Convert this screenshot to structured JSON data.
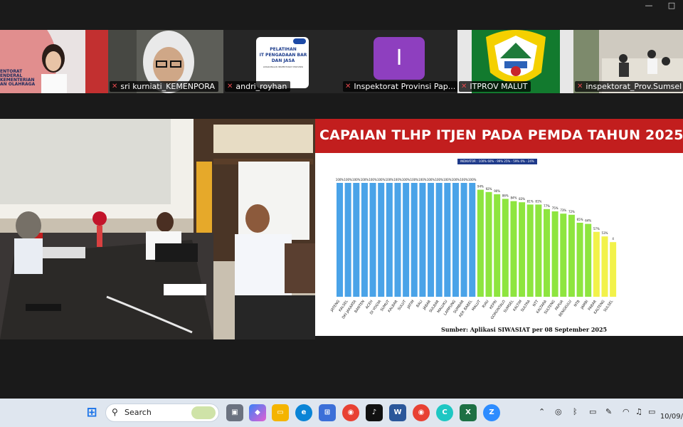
{
  "participants": [
    {
      "name": ""
    },
    {
      "name": "sri kurniati_KEMENPORA"
    },
    {
      "name": "andri_royhan"
    },
    {
      "name": "Inspektorat Provinsi Pap..."
    },
    {
      "name": "ITPROV MALUT"
    },
    {
      "name": "inspektorat_Prov.Sumsel"
    }
  ],
  "tile_texts": {
    "tile1_sign": "ENTORAT\nENDERAL\nKEMENTERIAN\nAN OLAHRAGA",
    "tile3_slide": "PELATIHAN\nIT PENGADAAN BAR\nDAN JASA",
    "tile3_sub": "LINGKUNGAN INSPEKTORAT PROVINSI",
    "tile4_initial": "I"
  },
  "shared_slide": {
    "title": "CAPAIAN TLHP ITJEN PADA PEMDA TAHUN 2025",
    "legend": "INDIKATOR :  100%   60% - 99%   25% - 59%   0% - 24%",
    "source": "Sumber: Aplikasi SIWASIAT per 08 September 2025",
    "colors": {
      "blue": "#4aa3e8",
      "green": "#8ee53f",
      "yellow": "#f2f24a",
      "banner": "#c21e1e"
    }
  },
  "chart_data": {
    "type": "bar",
    "title": "CAPAIAN TLHP ITJEN PADA PEMDA TAHUN 2025",
    "categories": [
      "JATENG",
      "KALSEL",
      "DKI JAKARTA",
      "BANTEN",
      "ACEH",
      "DI YOGYA",
      "SUMUT",
      "KALBAR",
      "SULUT",
      "JATIM",
      "BALI",
      "JABAR",
      "SULBAR",
      "MALUKU",
      "LAMPUNG",
      "SUMBAR",
      "KEP. BABEL",
      "MALUT",
      "RIAU",
      "KEPRI",
      "GORONTALO",
      "SUMSEL",
      "KALTIM",
      "SULTRA",
      "NTT",
      "KALTARA",
      "SULTENG",
      "PAPUA",
      "BENGKULU",
      "NTB",
      "JAMBI",
      "PABAR",
      "KALTENG",
      "SULSEL"
    ],
    "values": [
      100,
      100,
      100,
      100,
      100,
      100,
      100,
      100,
      100,
      100,
      100,
      100,
      100,
      100,
      100,
      100,
      100,
      94,
      92,
      90,
      86,
      84,
      83,
      81,
      81,
      77,
      75,
      73,
      72,
      65,
      64,
      57,
      53,
      48
    ],
    "value_labels": [
      "100%",
      "100%",
      "100%",
      "100%",
      "100%",
      "100%",
      "100%",
      "100%",
      "100%",
      "100%",
      "100%",
      "100%",
      "100%",
      "100%",
      "100%",
      "100%",
      "100%",
      "94%",
      "92%",
      "90%",
      "86%",
      "84%",
      "83%",
      "81%",
      "81%",
      "77%",
      "75%",
      "73%",
      "72%",
      "65%",
      "64%",
      "57%",
      "53%",
      "4"
    ],
    "ylim": [
      0,
      100
    ],
    "grid": false,
    "legend_position": "top-center"
  },
  "taskbar": {
    "search_label": "Search",
    "apps": [
      "windows",
      "file-explorer-dup",
      "task-view",
      "copilot",
      "file-explorer",
      "edge",
      "store",
      "chrome",
      "tiktok",
      "word",
      "chrome-profile",
      "canva",
      "excel",
      "zoom"
    ],
    "date": "10/09/"
  }
}
